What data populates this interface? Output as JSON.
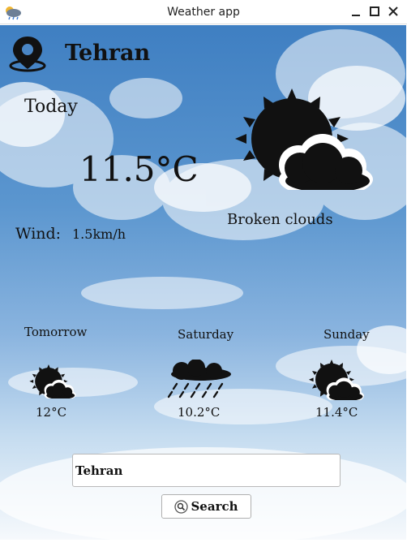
{
  "window": {
    "title": "Weather app",
    "app_icon": "weather-cloud-icon",
    "controls": [
      "minimize-icon",
      "maximize-icon",
      "close-icon"
    ]
  },
  "current": {
    "city": "Tehran",
    "today_label": "Today",
    "temperature": "11.5°C",
    "description": "Broken clouds",
    "wind_label": "Wind:",
    "wind_value": "1.5km/h",
    "icon": "sun-behind-clouds-icon"
  },
  "forecast": [
    {
      "day": "Tomorrow",
      "temp": "12°C",
      "icon": "sun-behind-clouds-icon"
    },
    {
      "day": "Saturday",
      "temp": "10.2°C",
      "icon": "rain-cloud-icon"
    },
    {
      "day": "Sunday",
      "temp": "11.4°C",
      "icon": "sun-behind-clouds-icon"
    }
  ],
  "search": {
    "value": "Tehran",
    "button_label": "Search",
    "button_icon": "search-icon"
  },
  "colors": {
    "sky_top": "#3f7fc2",
    "sky_bottom": "#f6f9fc",
    "icon_fill": "#111111"
  }
}
